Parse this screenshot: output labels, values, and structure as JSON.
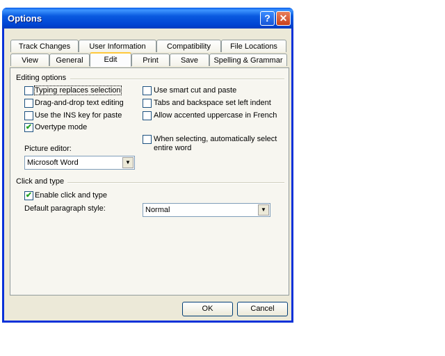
{
  "window": {
    "title": "Options",
    "help_button": "?",
    "close_button": "✕"
  },
  "tabs_back": [
    {
      "label": "Track Changes"
    },
    {
      "label": "User Information"
    },
    {
      "label": "Compatibility"
    },
    {
      "label": "File Locations"
    }
  ],
  "tabs_front": [
    {
      "label": "View"
    },
    {
      "label": "General"
    },
    {
      "label": "Edit"
    },
    {
      "label": "Print"
    },
    {
      "label": "Save"
    },
    {
      "label": "Spelling & Grammar"
    }
  ],
  "active_tab": "Edit",
  "editing_options": {
    "heading": "Editing options",
    "left": [
      {
        "label": "Typing replaces selection",
        "checked": false
      },
      {
        "label": "Drag-and-drop text editing",
        "checked": false
      },
      {
        "label": "Use the INS key for paste",
        "checked": false
      },
      {
        "label": "Overtype mode",
        "checked": true
      }
    ],
    "right": [
      {
        "label": "Use smart cut and paste",
        "checked": false
      },
      {
        "label": "Tabs and backspace set left indent",
        "checked": false
      },
      {
        "label": "Allow accented uppercase in French",
        "checked": false
      },
      {
        "label_line1": "When selecting, automatically select",
        "label_line2": "entire word",
        "checked": false
      }
    ],
    "picture_editor": {
      "label": "Picture editor:",
      "value": "Microsoft Word"
    }
  },
  "click_and_type": {
    "heading": "Click and type",
    "enable": {
      "label": "Enable click and type",
      "checked": true
    },
    "default_style": {
      "label": "Default paragraph style:",
      "value": "Normal"
    }
  },
  "buttons": {
    "ok": "OK",
    "cancel": "Cancel"
  }
}
